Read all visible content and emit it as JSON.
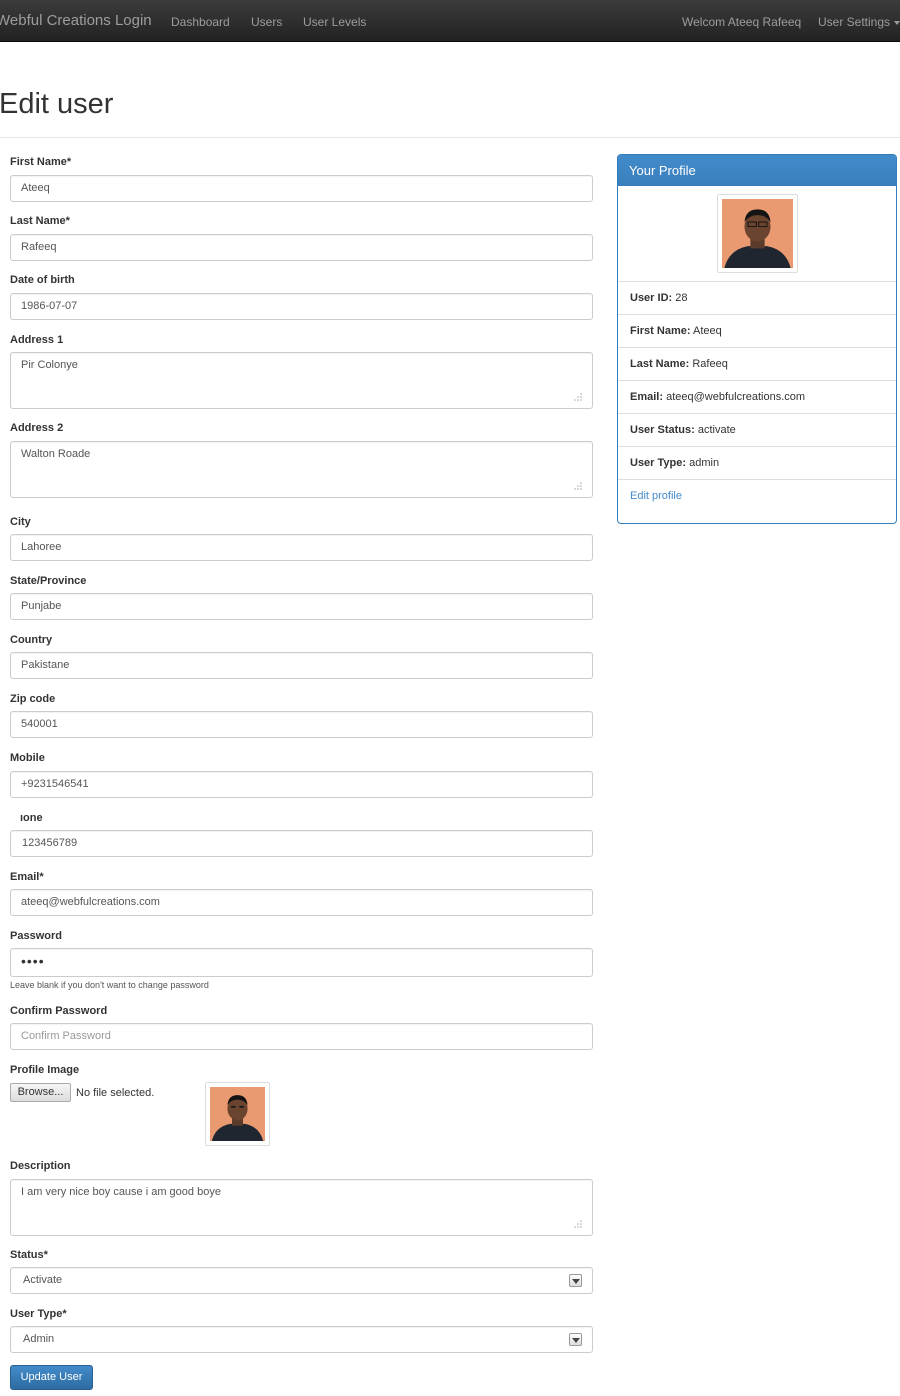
{
  "navbar": {
    "brand": "Webful Creations Login",
    "links": [
      "Dashboard",
      "Users",
      "User Levels"
    ],
    "welcome": "Welcom Ateeq Rafeeq",
    "settings": "User Settings",
    "bg_color": "#222222"
  },
  "page": {
    "title": "Edit user"
  },
  "form": {
    "first_name": {
      "label": "First Name*",
      "value": "Ateeq"
    },
    "last_name": {
      "label": "Last Name*",
      "value": "Rafeeq"
    },
    "dob": {
      "label": "Date of birth",
      "value": "1986-07-07"
    },
    "address1": {
      "label": "Address 1",
      "value": "Pir Colonye"
    },
    "address2": {
      "label": "Address 2",
      "value": "Walton Roade"
    },
    "city": {
      "label": "City",
      "value": "Lahoree"
    },
    "state": {
      "label": "State/Province",
      "value": "Punjabe"
    },
    "country": {
      "label": "Country",
      "value": "Pakistane"
    },
    "zip": {
      "label": "Zip code",
      "value": "540001"
    },
    "mobile": {
      "label": "Mobile",
      "value": "+9231546541"
    },
    "phone": {
      "label": "ıone",
      "value": "123456789"
    },
    "email": {
      "label": "Email*",
      "value": "ateeq@webfulcreations.com"
    },
    "password": {
      "label": "Password",
      "value": "••••",
      "help": "Leave blank if you don't want to change password"
    },
    "confirm_password": {
      "label": "Confirm Password",
      "placeholder": "Confirm Password"
    },
    "profile_image": {
      "label": "Profile Image",
      "browse": "Browse...",
      "status": "No file selected."
    },
    "description": {
      "label": "Description",
      "value": "I am very nice boy cause i am good boye"
    },
    "status": {
      "label": "Status*",
      "selected": "Activate"
    },
    "user_type": {
      "label": "User Type*",
      "selected": "Admin"
    },
    "submit": "Update User"
  },
  "profile_panel": {
    "title": "Your Profile",
    "user_id_label": "User ID:",
    "user_id": "28",
    "first_name_label": "First Name:",
    "first_name": "Ateeq",
    "last_name_label": "Last Name:",
    "last_name": "Rafeeq",
    "email_label": "Email:",
    "email": "ateeq@webfulcreations.com",
    "status_label": "User Status:",
    "status": "activate",
    "type_label": "User Type:",
    "type": "admin",
    "edit_link": "Edit profile",
    "accent_color": "#428bca"
  }
}
